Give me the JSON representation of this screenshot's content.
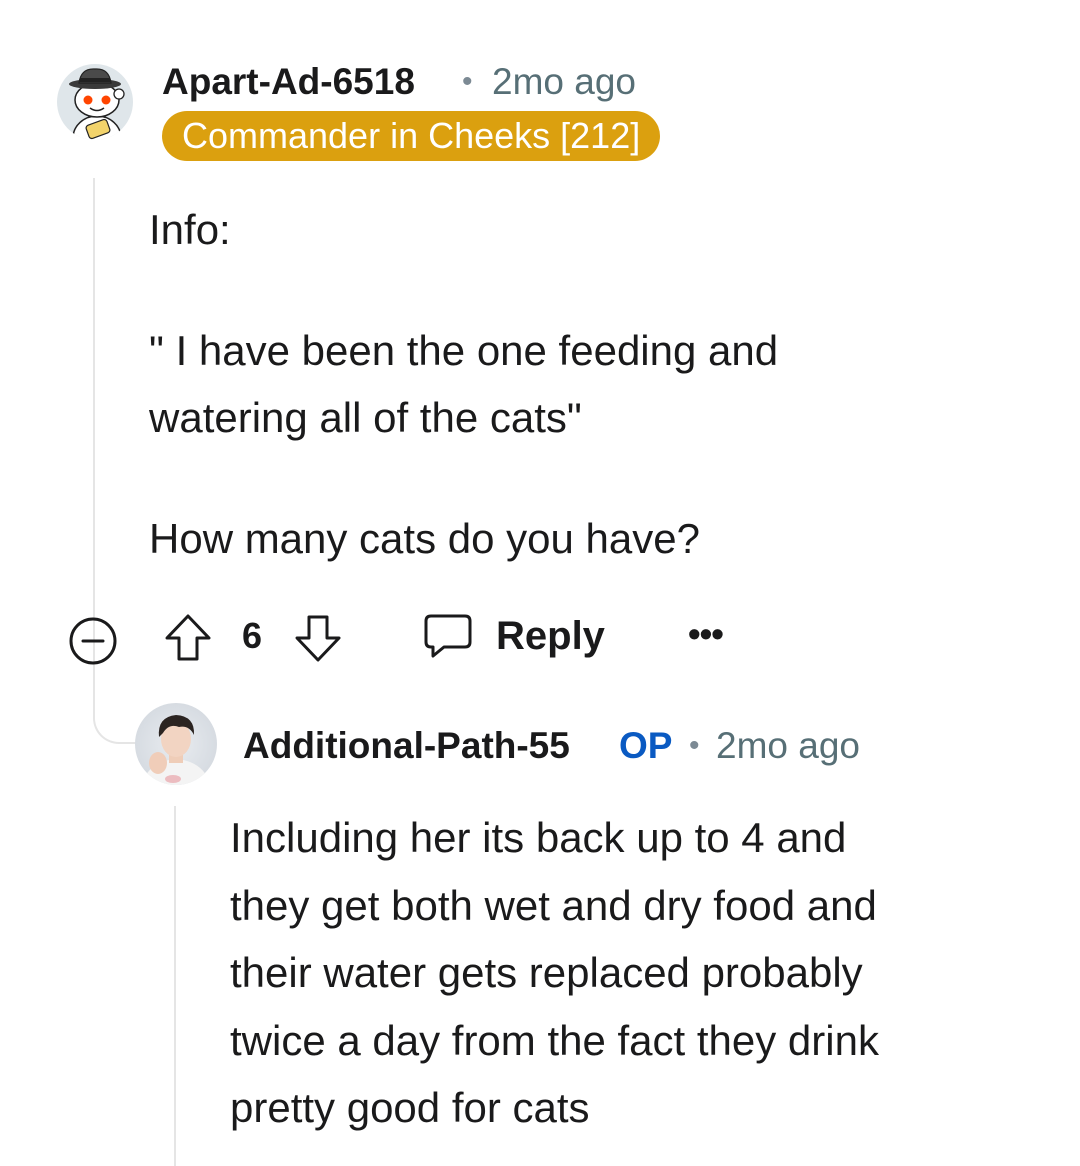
{
  "comments": [
    {
      "author": "Apart-Ad-6518",
      "separator": "•",
      "time": "2mo ago",
      "flair": "Commander in Cheeks [212]",
      "body": {
        "line1": "Info:",
        "line2": "\" I have been the one feeding and",
        "line3": "watering all of the cats\"",
        "line4": "How many cats do you have?"
      },
      "actions": {
        "vote_count": "6",
        "reply_label": "Reply",
        "more_label": "•••"
      }
    },
    {
      "author": "Additional-Path-55",
      "op_badge": "OP",
      "separator": "•",
      "time": "2mo ago",
      "body": "Including her its back up to 4 and\nthey get both wet and dry food and\ntheir water gets replaced probably\ntwice a day from the fact they drink\npretty good for cats"
    }
  ],
  "colors": {
    "flair_bg": "#dba00f",
    "op_badge": "#0a5ac2",
    "meta_text": "#576f76",
    "thread_line": "#e5e5e5"
  },
  "icons": {
    "avatar1": "snoo-avatar-fedora",
    "avatar2": "user-photo-avatar",
    "collapse": "minus-circle-icon",
    "upvote": "upvote-arrow-icon",
    "downvote": "downvote-arrow-icon",
    "reply": "speech-bubble-icon",
    "more": "ellipsis-icon"
  }
}
